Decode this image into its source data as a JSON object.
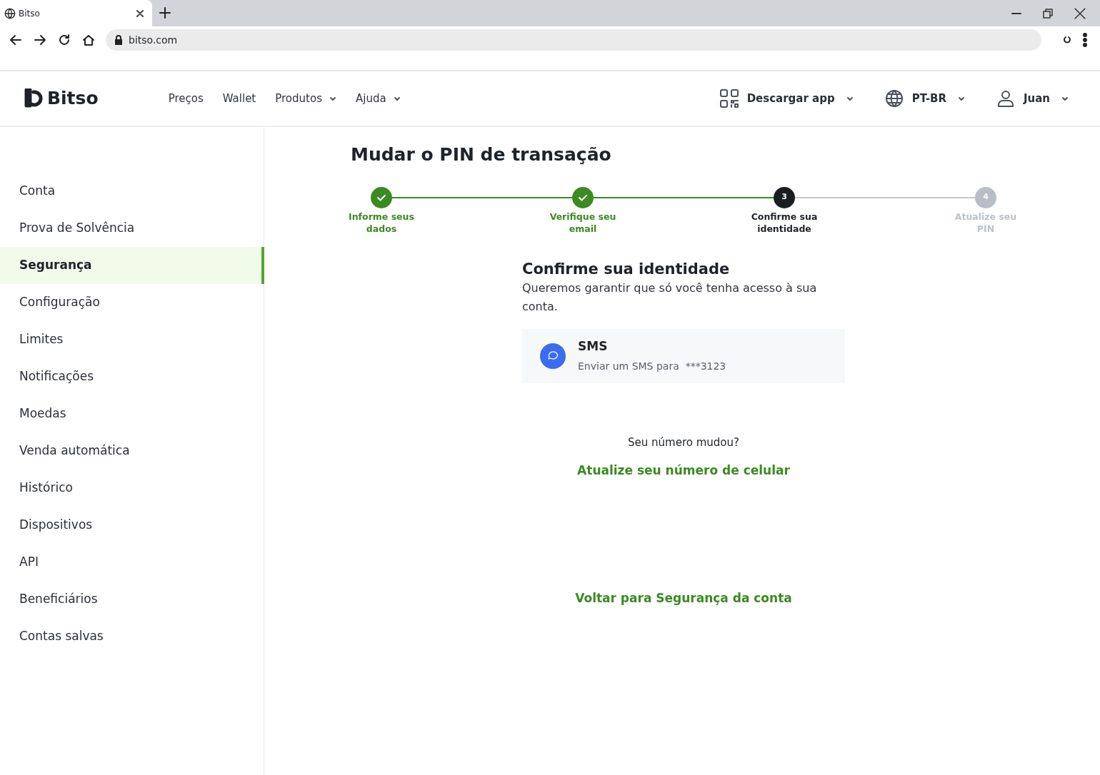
{
  "browser": {
    "tab_title": "Bitso",
    "url": "bitso.com"
  },
  "header": {
    "logo": "Bitso",
    "nav": [
      {
        "label": "Preços",
        "dropdown": false
      },
      {
        "label": "Wallet",
        "dropdown": false
      },
      {
        "label": "Produtos",
        "dropdown": true
      },
      {
        "label": "Ajuda",
        "dropdown": true
      }
    ],
    "actions": [
      {
        "kind": "qr",
        "label": "Descargar app"
      },
      {
        "kind": "globe",
        "label": "PT-BR"
      },
      {
        "kind": "user",
        "label": "Juan"
      }
    ]
  },
  "sidebar": {
    "items": [
      {
        "label": "Conta",
        "selected": false
      },
      {
        "label": "Prova de Solvência",
        "selected": false
      },
      {
        "label": "Segurança",
        "selected": true
      },
      {
        "label": "Configuração",
        "selected": false
      },
      {
        "label": "Limites",
        "selected": false
      },
      {
        "label": "Notificações",
        "selected": false
      },
      {
        "label": "Moedas",
        "selected": false
      },
      {
        "label": "Venda automática",
        "selected": false
      },
      {
        "label": "Histórico",
        "selected": false
      },
      {
        "label": "Dispositivos",
        "selected": false
      },
      {
        "label": "API",
        "selected": false
      },
      {
        "label": "Beneficiários",
        "selected": false
      },
      {
        "label": "Contas salvas",
        "selected": false
      }
    ]
  },
  "page_title": "Mudar o PIN de transação",
  "steps": [
    {
      "label": "Informe seus dados",
      "completed": true,
      "current": false
    },
    {
      "label": "Verifique seu email",
      "completed": true,
      "current": false
    },
    {
      "number": "3",
      "label": "Confirme sua identidade",
      "completed": false,
      "current": true
    },
    {
      "number": "4",
      "label": "Atualize seu PIN",
      "completed": false,
      "current": false
    }
  ],
  "section": {
    "title": "Confirme sua identidade",
    "description": "Queremos garantir que só você tenha acesso à sua conta.",
    "option": {
      "title": "SMS",
      "subtitle": "Enviar um SMS para  ***3123"
    },
    "question": "Seu número mudou?",
    "update_link": "Atualize seu número de celular"
  },
  "back_link": "Voltar para Segurança da conta"
}
